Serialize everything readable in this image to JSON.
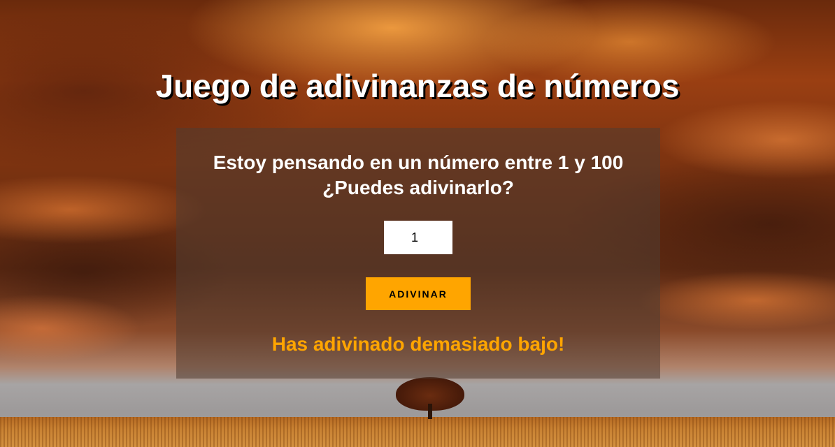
{
  "game": {
    "title": "Juego de adivinanzas de números",
    "prompt_line1": "Estoy pensando en un número entre 1 y 100",
    "prompt_line2": "¿Puedes adivinarlo?",
    "guess_value": "1",
    "guess_button_label": "ADIVINAR",
    "result_message": "Has adivinado demasiado bajo!"
  },
  "colors": {
    "accent": "#ffa500",
    "title_text": "#ffffff",
    "panel_background": "rgba(80, 60, 50, 0.55)"
  }
}
